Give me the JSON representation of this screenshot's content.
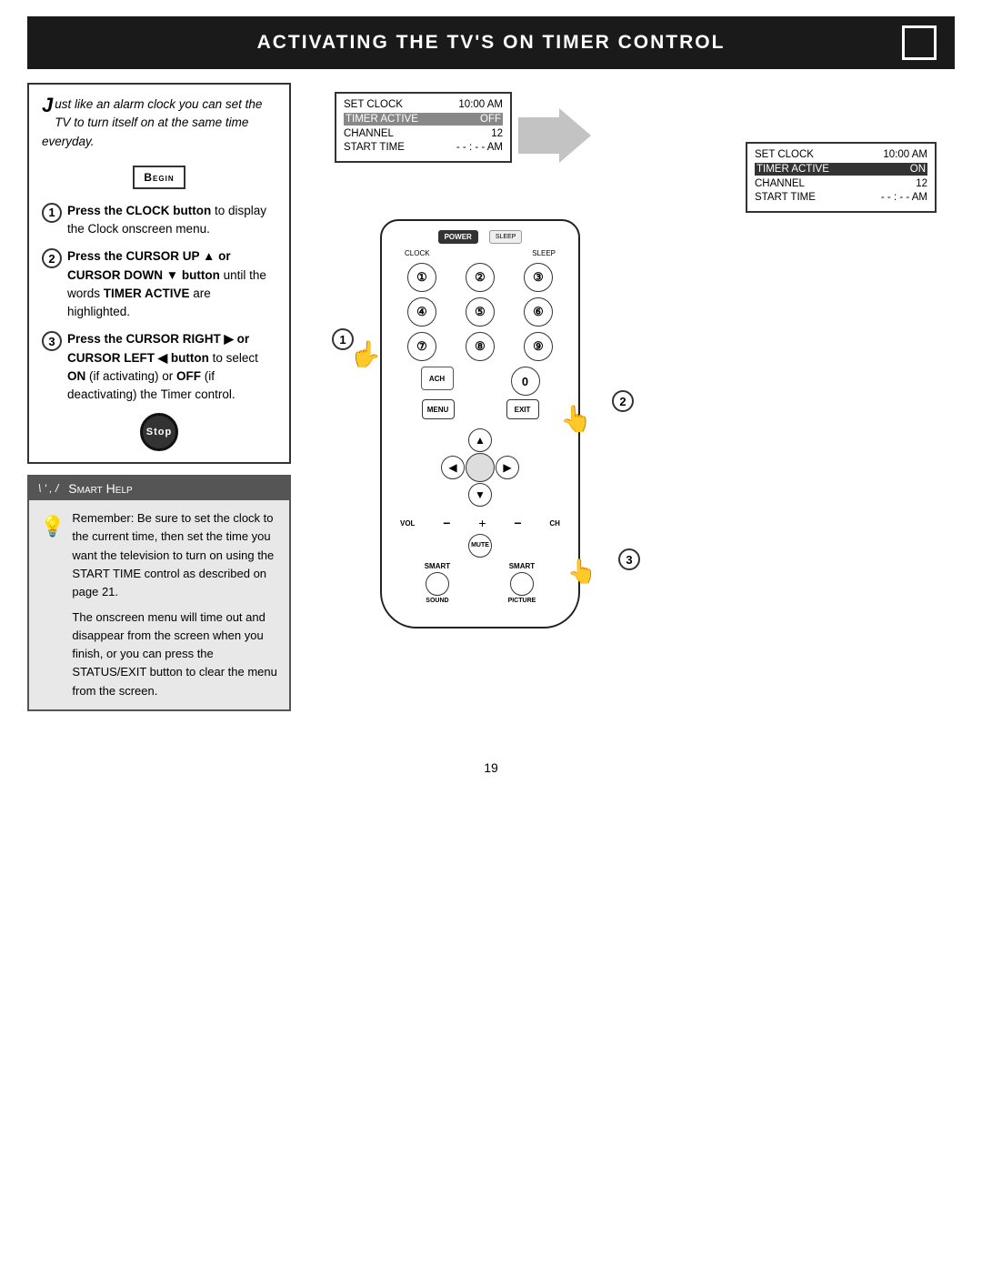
{
  "page": {
    "number": "19",
    "title": "Activating the TV's On Timer Control",
    "header_box": ""
  },
  "intro": {
    "drop_cap": "J",
    "text": "ust like an alarm clock you can set the TV to turn itself on at the same time everyday."
  },
  "begin_label": "Begin",
  "steps": [
    {
      "number": "1",
      "text_parts": [
        {
          "bold": true,
          "text": "Press the CLOCK button"
        },
        {
          "bold": false,
          "text": " to display the Clock onscreen menu."
        }
      ]
    },
    {
      "number": "2",
      "text_parts": [
        {
          "bold": true,
          "text": "Press the CURSOR UP ▲ or CURSOR DOWN ▼ button"
        },
        {
          "bold": false,
          "text": " until the words "
        },
        {
          "bold": true,
          "text": "TIMER ACTIVE"
        },
        {
          "bold": false,
          "text": " are highlighted."
        }
      ]
    },
    {
      "number": "3",
      "text_parts": [
        {
          "bold": true,
          "text": "Press the CURSOR RIGHT ▶ or CURSOR LEFT ◀ button"
        },
        {
          "bold": false,
          "text": " to select "
        },
        {
          "bold": true,
          "text": "ON"
        },
        {
          "bold": false,
          "text": " (if activating) or "
        },
        {
          "bold": true,
          "text": "OFF"
        },
        {
          "bold": false,
          "text": " (if deactivating) the Timer control."
        }
      ]
    }
  ],
  "stop_label": "Stop",
  "smart_help": {
    "title": "Smart Help",
    "lines_decoration": "\\' \\, /'",
    "paragraph1": "Remember: Be sure to set the clock to the current time, then set the time you want the television to turn on using the START TIME control as described on page 21.",
    "paragraph2": "The onscreen menu will time out and disappear from the screen when you finish, or you can press the STATUS/EXIT button to clear the menu from the screen."
  },
  "screen_before": {
    "row1_label": "SET CLOCK",
    "row1_value": "10:00 AM",
    "row2_label": "TIMER ACTIVE",
    "row2_value": "OFF",
    "row3_label": "CHANNEL",
    "row3_value": "12",
    "row4_label": "START TIME",
    "row4_value": "- - : - - AM"
  },
  "screen_after": {
    "row1_label": "SET CLOCK",
    "row1_value": "10:00 AM",
    "row2_label": "TIMER ACTIVE",
    "row2_value": "ON",
    "row3_label": "CHANNEL",
    "row3_value": "12",
    "row4_label": "START TIME",
    "row4_value": "- - : - - AM"
  },
  "remote": {
    "power_label": "POWER",
    "sleep_label": "SLEEP",
    "clock_label": "CLOCK",
    "buttons": [
      "1",
      "2",
      "3",
      "4",
      "5",
      "6",
      "7",
      "8",
      "9"
    ],
    "acn_label": "ACH",
    "zero_label": "0",
    "menu_label": "MENU",
    "exit_label": "EXIT",
    "vol_label": "VOL",
    "ch_label": "CH",
    "mute_label": "MUTE",
    "smart_sound_label": "SOUND",
    "smart_picture_label": "PICTURE",
    "smart_label": "SMART"
  }
}
